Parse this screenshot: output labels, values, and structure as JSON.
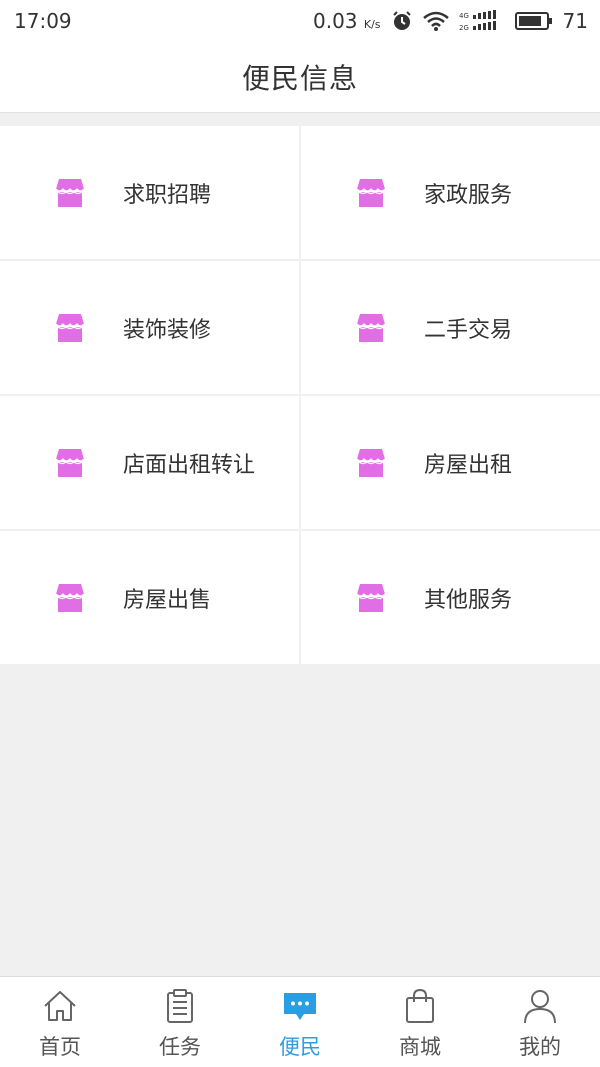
{
  "status": {
    "time": "17:09",
    "speed": "0.03",
    "speed_unit": "K/s",
    "battery": "71"
  },
  "header": {
    "title": "便民信息"
  },
  "categories": [
    {
      "label": "求职招聘",
      "icon": "shop-icon"
    },
    {
      "label": "家政服务",
      "icon": "shop-icon"
    },
    {
      "label": "装饰装修",
      "icon": "shop-icon"
    },
    {
      "label": "二手交易",
      "icon": "shop-icon"
    },
    {
      "label": "店面出租转让",
      "icon": "shop-icon"
    },
    {
      "label": "房屋出租",
      "icon": "shop-icon"
    },
    {
      "label": "房屋出售",
      "icon": "shop-icon"
    },
    {
      "label": "其他服务",
      "icon": "shop-icon"
    }
  ],
  "tabbar": {
    "items": [
      {
        "label": "首页",
        "icon": "home-icon"
      },
      {
        "label": "任务",
        "icon": "clipboard-icon"
      },
      {
        "label": "便民",
        "icon": "chat-bubble-icon",
        "active": true
      },
      {
        "label": "商城",
        "icon": "shopping-bag-icon"
      },
      {
        "label": "我的",
        "icon": "user-icon"
      }
    ]
  },
  "colors": {
    "accent": "#2b9de3",
    "icon_pink": "#e26ee6",
    "background": "#f0f0f0"
  }
}
